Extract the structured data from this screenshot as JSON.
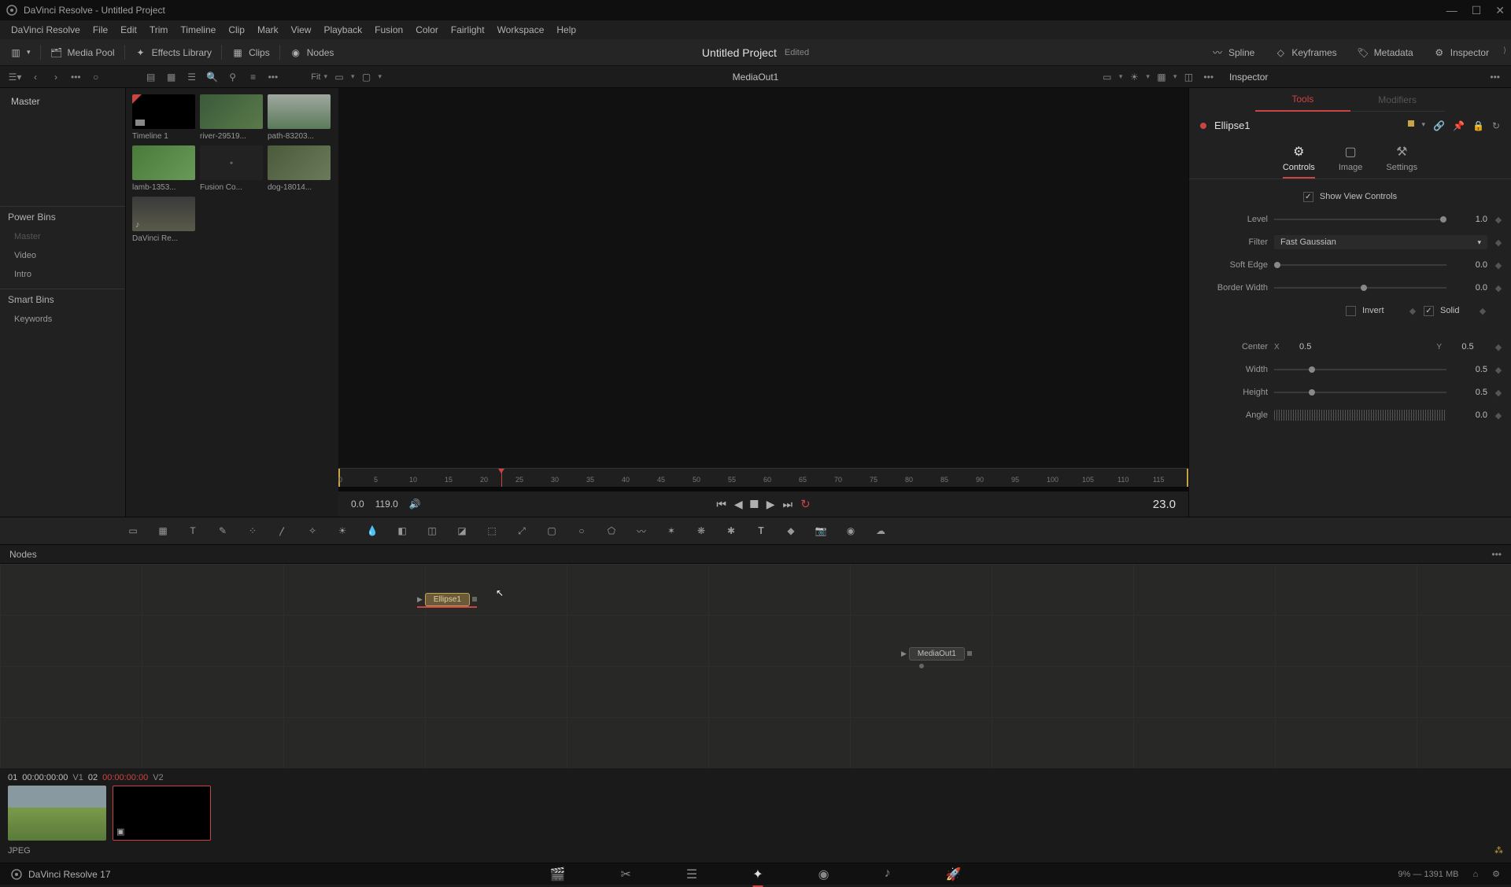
{
  "titlebar": {
    "title": "DaVinci Resolve - Untitled Project"
  },
  "menu": [
    "DaVinci Resolve",
    "File",
    "Edit",
    "Trim",
    "Timeline",
    "Clip",
    "Mark",
    "View",
    "Playback",
    "Fusion",
    "Color",
    "Fairlight",
    "Workspace",
    "Help"
  ],
  "toolbar": {
    "media_pool": "Media Pool",
    "effects": "Effects Library",
    "clips": "Clips",
    "nodes": "Nodes",
    "project": "Untitled Project",
    "edited": "Edited",
    "spline": "Spline",
    "keyframes": "Keyframes",
    "metadata": "Metadata",
    "inspector": "Inspector"
  },
  "subbar": {
    "fit": "Fit",
    "viewer_title": "MediaOut1",
    "inspector": "Inspector"
  },
  "left_panel": {
    "master": "Master",
    "power_bins": "Power Bins",
    "items": [
      "Master",
      "Video",
      "Intro"
    ],
    "smart_bins": "Smart Bins",
    "keywords": "Keywords"
  },
  "media": [
    {
      "label": "Timeline 1",
      "cls": "t1"
    },
    {
      "label": "river-29519...",
      "cls": "t2"
    },
    {
      "label": "path-83203...",
      "cls": "t3"
    },
    {
      "label": "lamb-1353...",
      "cls": "t4"
    },
    {
      "label": "Fusion Co...",
      "cls": "t5"
    },
    {
      "label": "dog-18014...",
      "cls": "t6"
    },
    {
      "label": "DaVinci Re...",
      "cls": "t7"
    }
  ],
  "ruler": {
    "ticks": [
      0,
      5,
      10,
      15,
      20,
      25,
      30,
      35,
      40,
      45,
      50,
      55,
      60,
      65,
      70,
      75,
      80,
      85,
      90,
      95,
      100,
      105,
      110,
      115
    ],
    "playhead": 23
  },
  "transport": {
    "in": "0.0",
    "out": "119.0",
    "current": "23.0"
  },
  "inspector": {
    "tabs": [
      "Tools",
      "Modifiers"
    ],
    "node": "Ellipse1",
    "subtabs": [
      "Controls",
      "Image",
      "Settings"
    ],
    "show_view": "Show View Controls",
    "level": {
      "label": "Level",
      "value": "1.0"
    },
    "filter": {
      "label": "Filter",
      "value": "Fast Gaussian"
    },
    "soft_edge": {
      "label": "Soft Edge",
      "value": "0.0"
    },
    "border_width": {
      "label": "Border Width",
      "value": "0.0"
    },
    "invert": "Invert",
    "solid": "Solid",
    "center": {
      "label": "Center",
      "x": "0.5",
      "y": "0.5"
    },
    "width": {
      "label": "Width",
      "value": "0.5"
    },
    "height": {
      "label": "Height",
      "value": "0.5"
    },
    "angle": {
      "label": "Angle",
      "value": "0.0"
    }
  },
  "nodes_panel": {
    "title": "Nodes",
    "ellipse": "Ellipse1",
    "mediaout": "MediaOut1"
  },
  "clips_strip": {
    "c1_idx": "01",
    "c1_tc": "00:00:00:00",
    "c1_v": "V1",
    "c2_idx": "02",
    "c2_tc": "00:00:00:00",
    "c2_v": "V2",
    "format": "JPEG"
  },
  "statusbar": {
    "app": "DaVinci Resolve 17",
    "mem": "9% — 1391 MB"
  }
}
